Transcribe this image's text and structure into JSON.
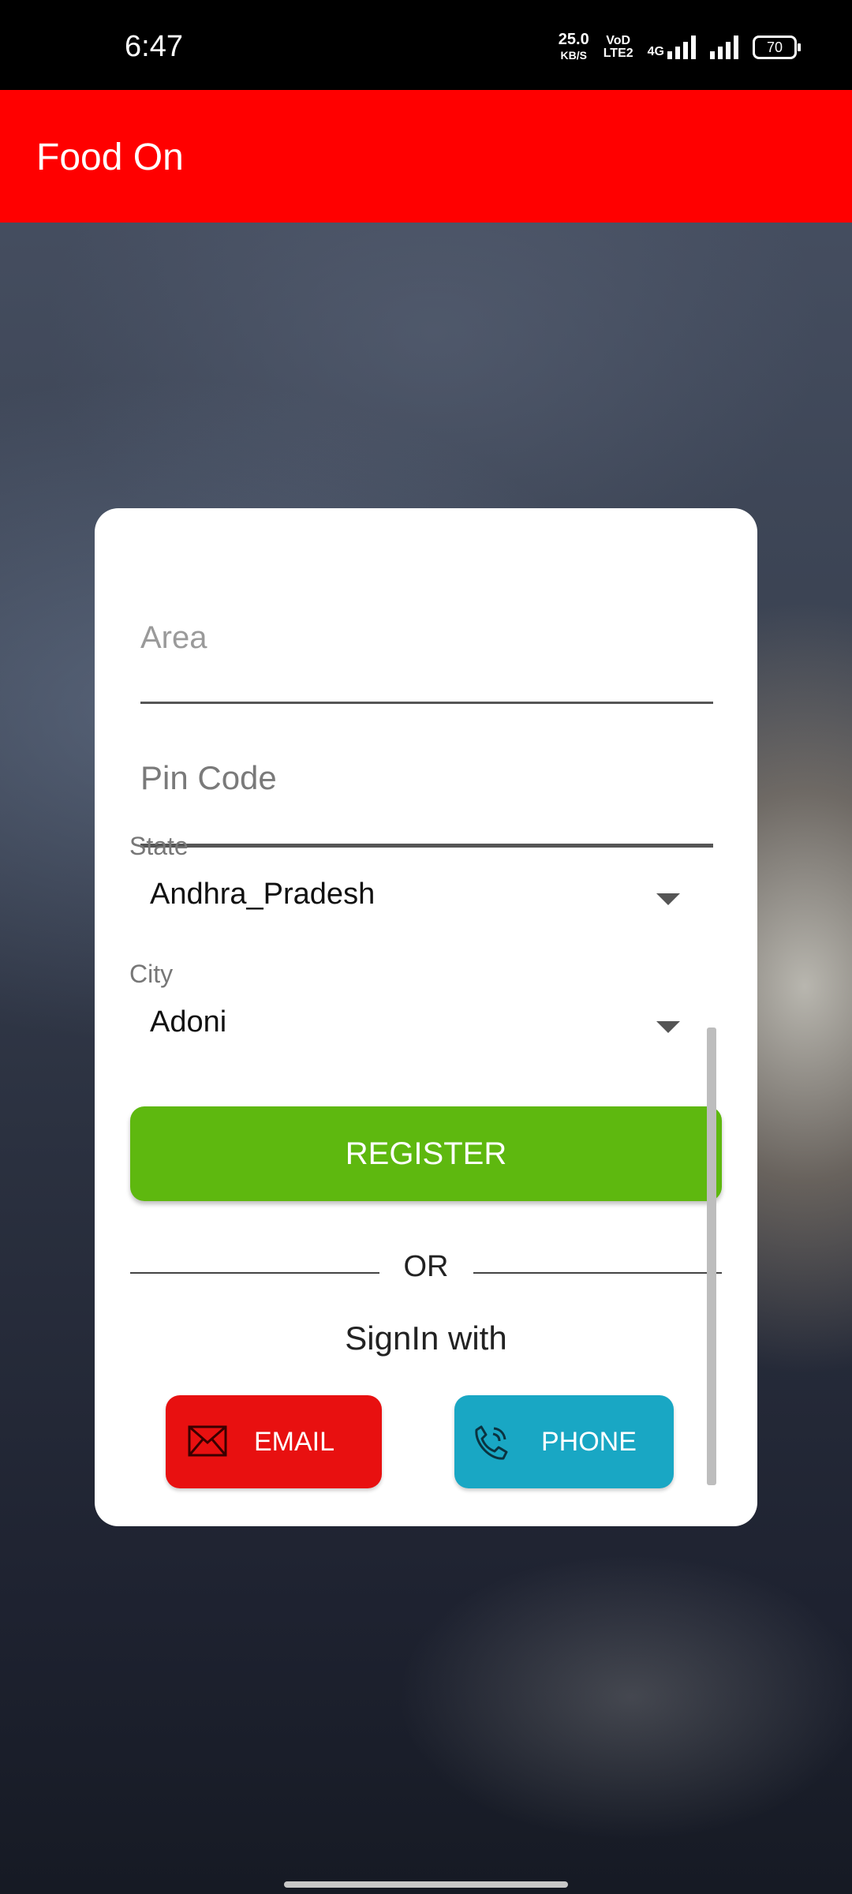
{
  "status_bar": {
    "time": "6:47",
    "net_speed_value": "25.0",
    "net_speed_unit": "KB/S",
    "vol_tag_top": "VoD",
    "vol_tag_bottom": "LTE2",
    "network_type": "4G",
    "battery": "70"
  },
  "app_bar": {
    "title": "Food On",
    "color": "#ff0000"
  },
  "form": {
    "area_placeholder": "Area",
    "pincode_placeholder": "Pin Code",
    "state_label": "State",
    "state_value": "Andhra_Pradesh",
    "city_label": "City",
    "city_value": "Adoni",
    "register_label": "REGISTER",
    "or_text": "OR",
    "signin_text": "SignIn with",
    "email_label": "EMAIL",
    "phone_label": "PHONE"
  },
  "colors": {
    "register": "#5eb80f",
    "email": "#e81010",
    "phone": "#19a7c4"
  }
}
